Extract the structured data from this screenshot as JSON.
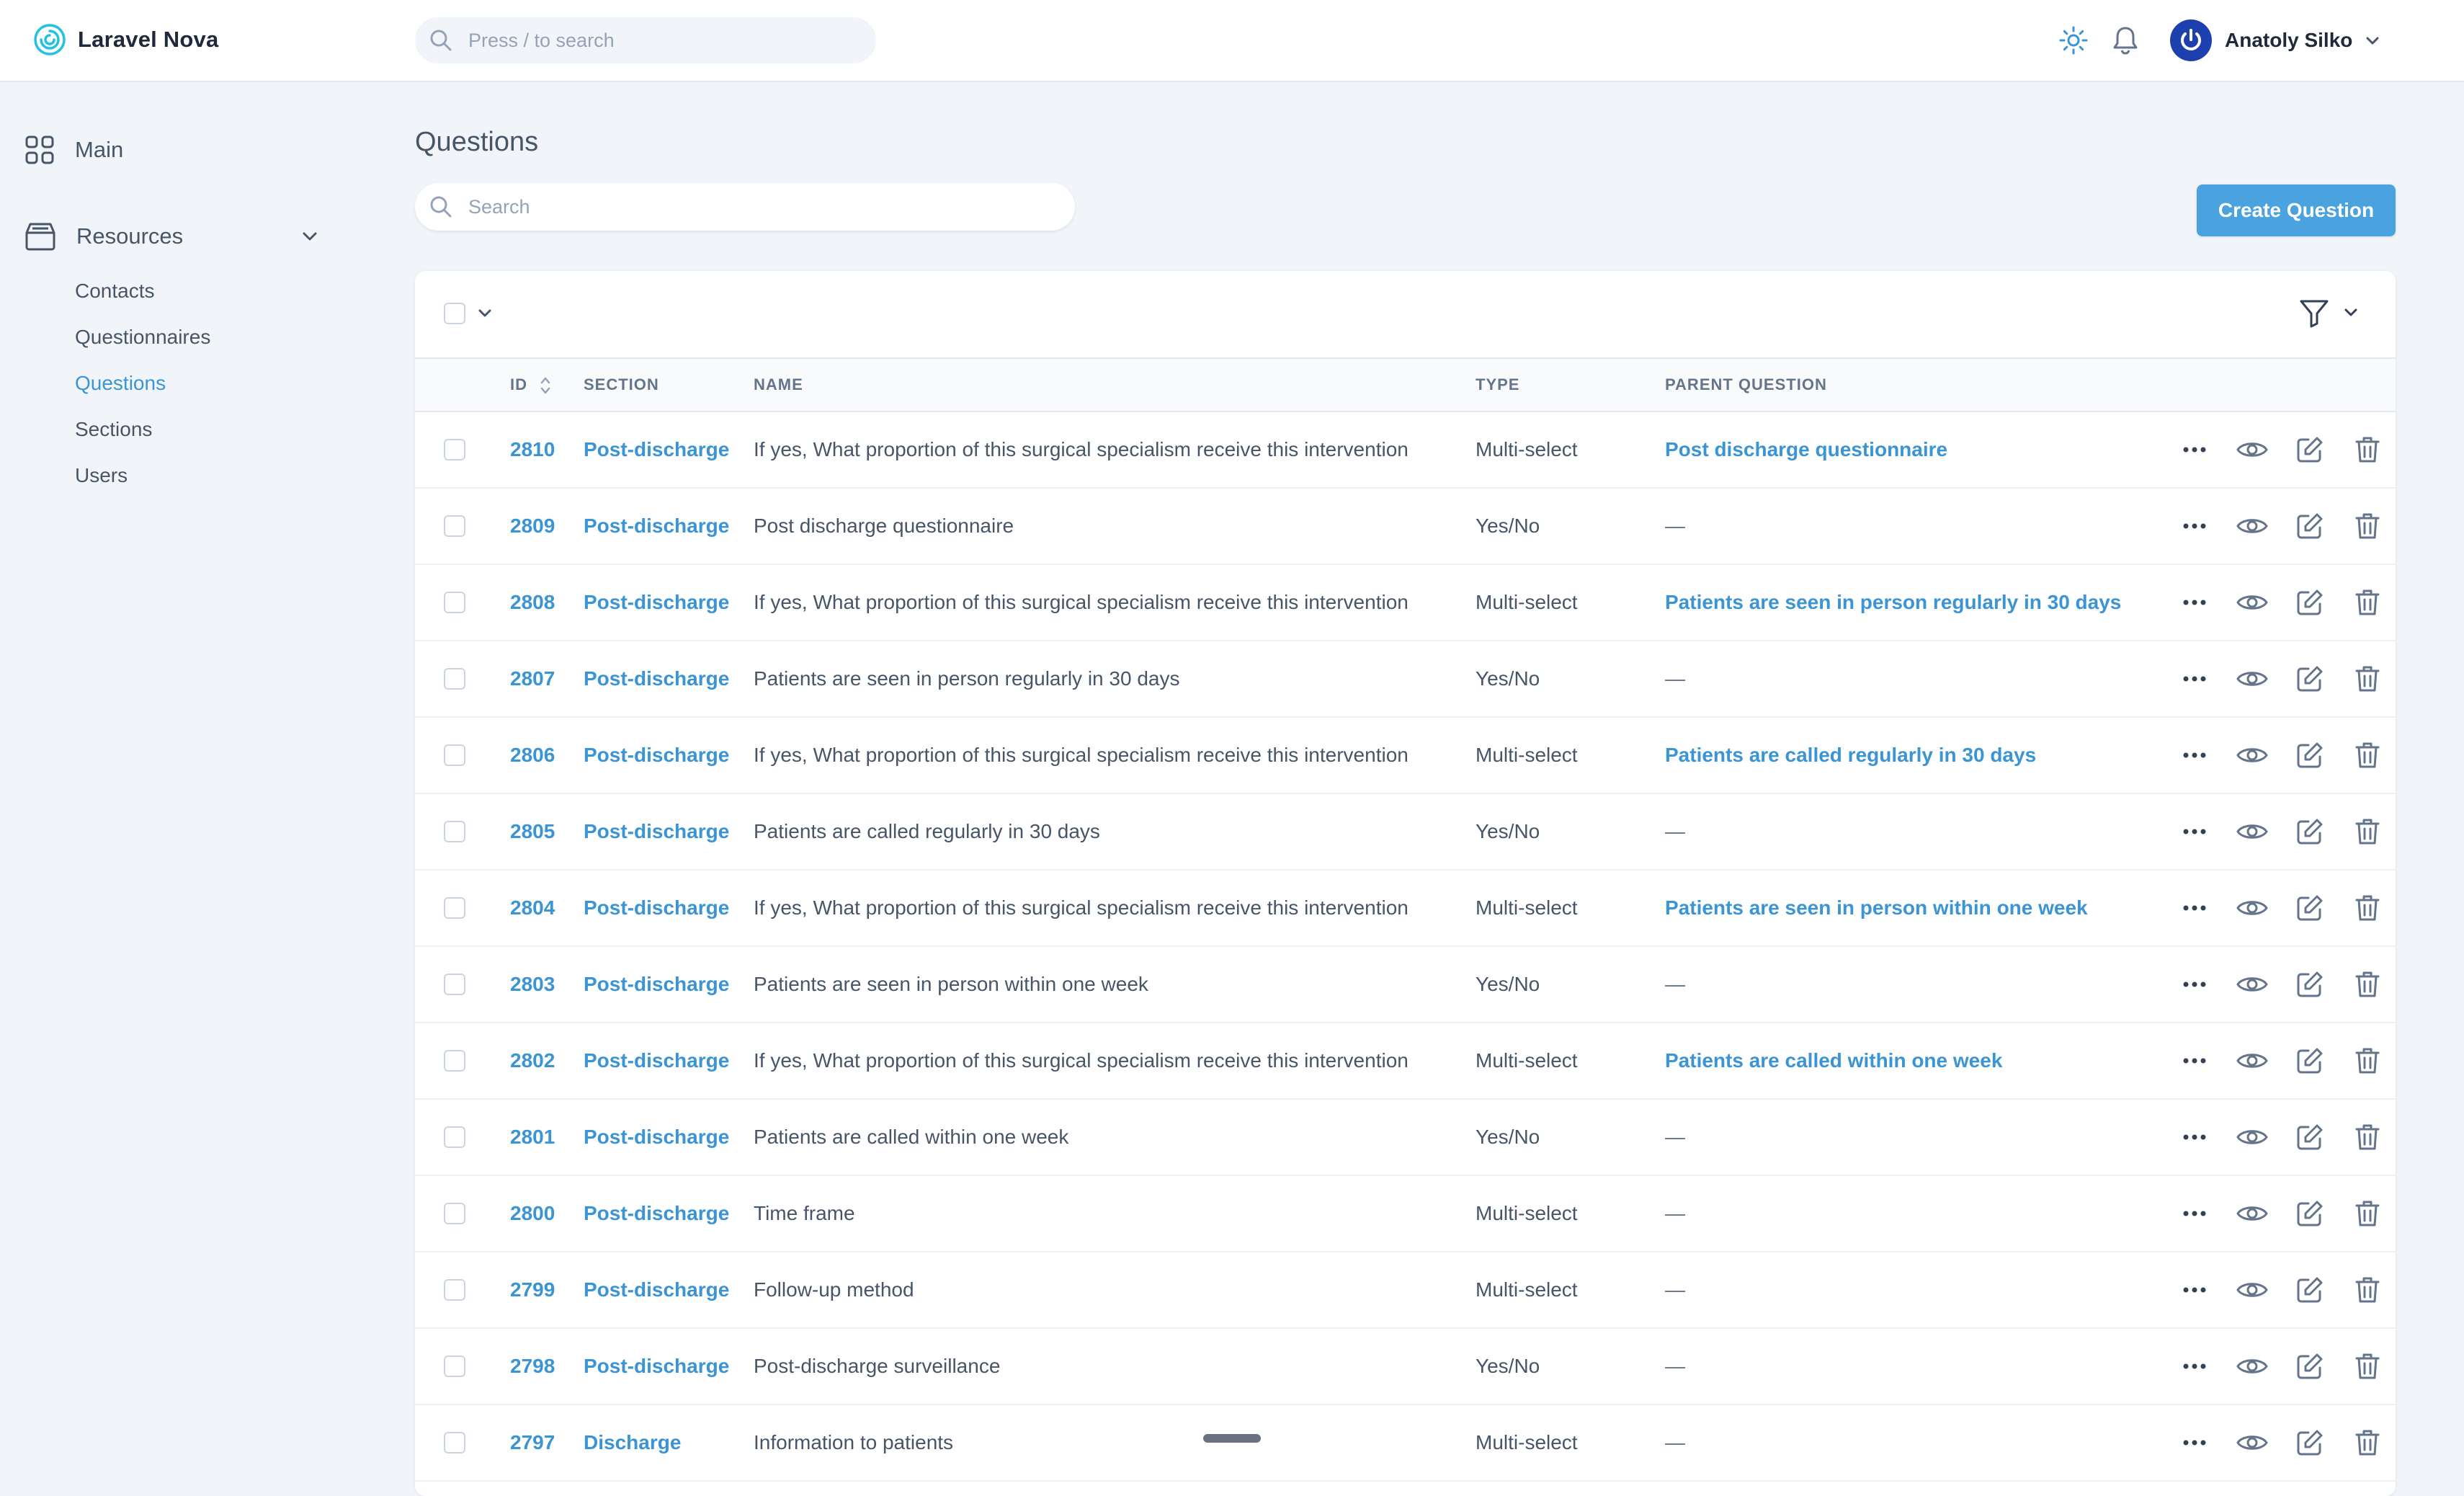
{
  "app": {
    "brand": "Laravel Nova"
  },
  "header": {
    "search_placeholder": "Press / to search",
    "user_name": "Anatoly Silko"
  },
  "sidebar": {
    "main_label": "Main",
    "resources_label": "Resources",
    "items": [
      {
        "label": "Contacts",
        "active": false
      },
      {
        "label": "Questionnaires",
        "active": false
      },
      {
        "label": "Questions",
        "active": true
      },
      {
        "label": "Sections",
        "active": false
      },
      {
        "label": "Users",
        "active": false
      }
    ]
  },
  "page": {
    "title": "Questions",
    "search_placeholder": "Search",
    "create_button": "Create Question"
  },
  "table": {
    "columns": {
      "id": "ID",
      "section": "SECTION",
      "name": "NAME",
      "type": "TYPE",
      "parent": "PARENT QUESTION"
    },
    "rows": [
      {
        "id": "2810",
        "section": "Post-discharge",
        "name": "If yes, What proportion of this surgical specialism receive this intervention",
        "type": "Multi-select",
        "parent": "Post discharge questionnaire"
      },
      {
        "id": "2809",
        "section": "Post-discharge",
        "name": "Post discharge questionnaire",
        "type": "Yes/No",
        "parent": "—"
      },
      {
        "id": "2808",
        "section": "Post-discharge",
        "name": "If yes, What proportion of this surgical specialism receive this intervention",
        "type": "Multi-select",
        "parent": "Patients are seen in person regularly in 30 days"
      },
      {
        "id": "2807",
        "section": "Post-discharge",
        "name": "Patients are seen in person regularly in 30 days",
        "type": "Yes/No",
        "parent": "—"
      },
      {
        "id": "2806",
        "section": "Post-discharge",
        "name": "If yes, What proportion of this surgical specialism receive this intervention",
        "type": "Multi-select",
        "parent": "Patients are called regularly in 30 days"
      },
      {
        "id": "2805",
        "section": "Post-discharge",
        "name": "Patients are called regularly in 30 days",
        "type": "Yes/No",
        "parent": "—"
      },
      {
        "id": "2804",
        "section": "Post-discharge",
        "name": "If yes, What proportion of this surgical specialism receive this intervention",
        "type": "Multi-select",
        "parent": "Patients are seen in person within one week"
      },
      {
        "id": "2803",
        "section": "Post-discharge",
        "name": "Patients are seen in person within one week",
        "type": "Yes/No",
        "parent": "—"
      },
      {
        "id": "2802",
        "section": "Post-discharge",
        "name": "If yes, What proportion of this surgical specialism receive this intervention",
        "type": "Multi-select",
        "parent": "Patients are called within one week"
      },
      {
        "id": "2801",
        "section": "Post-discharge",
        "name": "Patients are called within one week",
        "type": "Yes/No",
        "parent": "—"
      },
      {
        "id": "2800",
        "section": "Post-discharge",
        "name": "Time frame",
        "type": "Multi-select",
        "parent": "—"
      },
      {
        "id": "2799",
        "section": "Post-discharge",
        "name": "Follow-up method",
        "type": "Multi-select",
        "parent": "—"
      },
      {
        "id": "2798",
        "section": "Post-discharge",
        "name": "Post-discharge surveillance",
        "type": "Yes/No",
        "parent": "—"
      },
      {
        "id": "2797",
        "section": "Discharge",
        "name": "Information to patients",
        "type": "Multi-select",
        "parent": "—"
      }
    ]
  },
  "icons": {
    "brand": "nova-spiral-icon",
    "theme": "sun-icon",
    "notifications": "bell-icon",
    "avatar": "power-icon",
    "row_actions": [
      "more-dots-icon",
      "eye-icon",
      "edit-icon",
      "trash-icon"
    ]
  },
  "colors": {
    "accent": "#4aa3df",
    "link": "#3b94d4",
    "background": "#f1f5f9",
    "avatar": "#1e40af"
  }
}
